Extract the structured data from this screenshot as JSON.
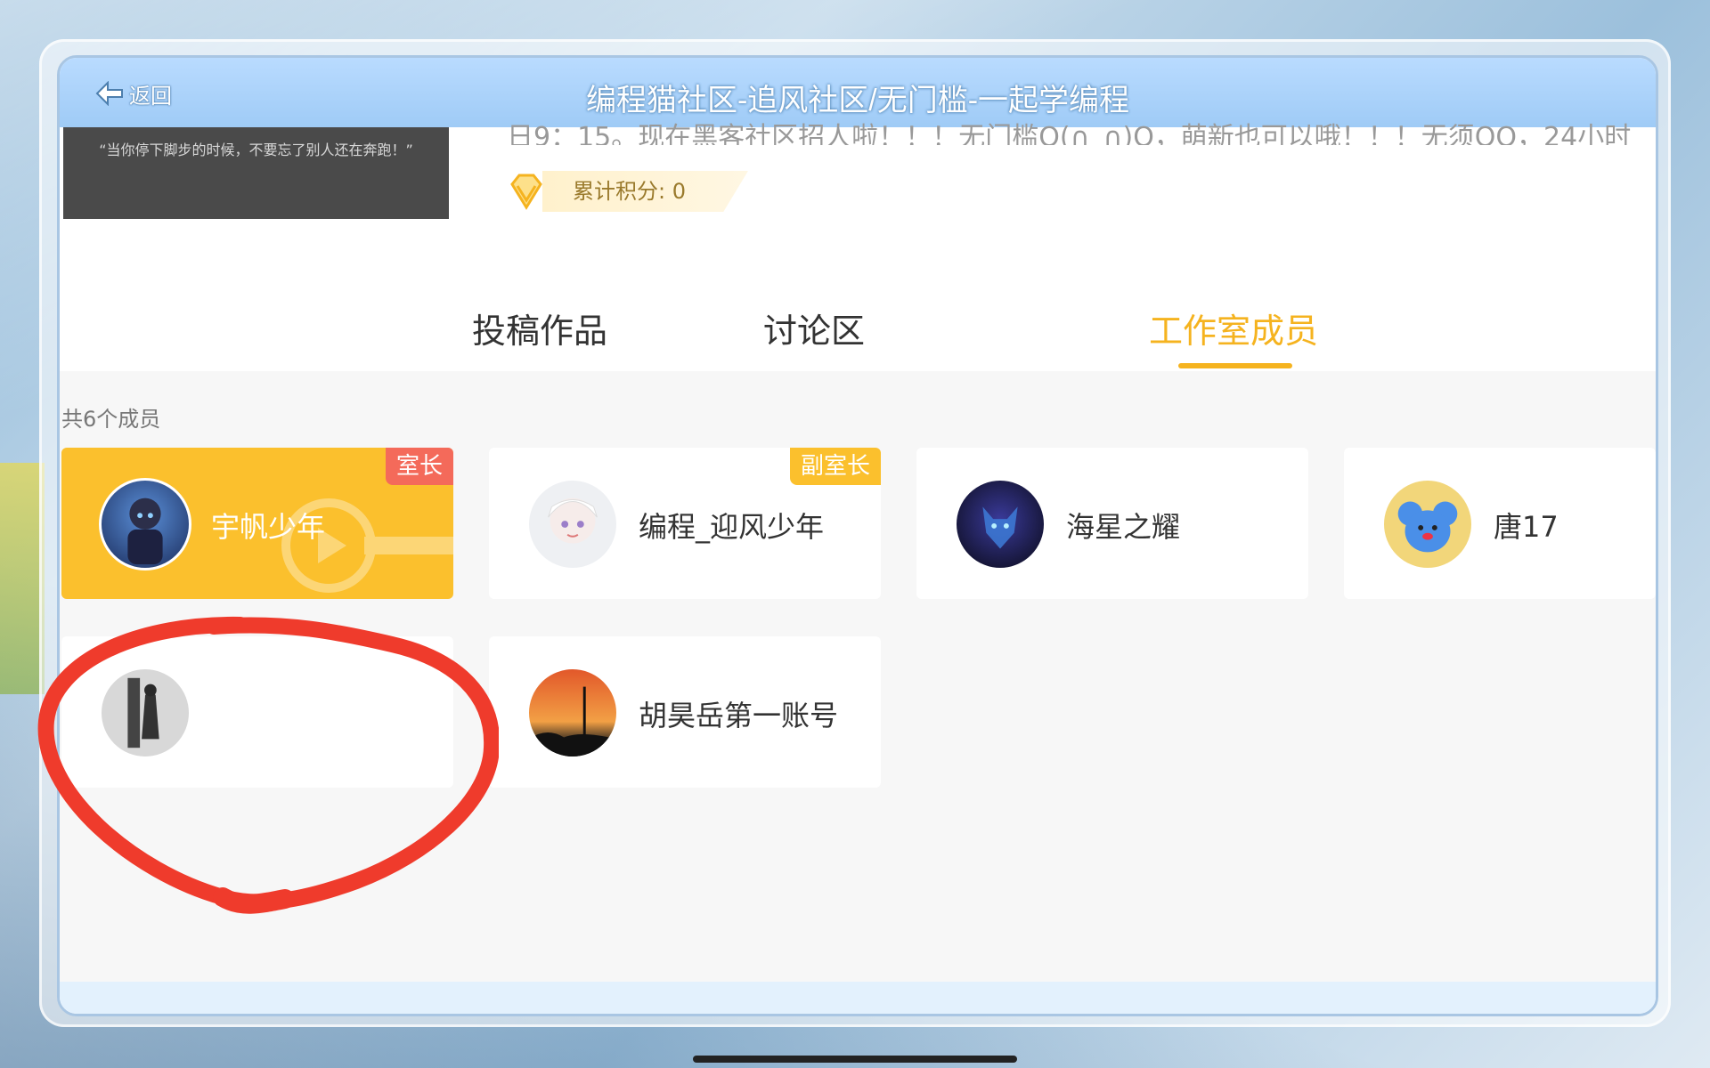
{
  "app": {
    "title": "编程猫社区-追风社区/无门槛-一起学编程",
    "back_label": "返回"
  },
  "studio": {
    "cover_quote": "“当你停下脚步的时候，不要忘了别人还在奔跑！”",
    "description": "日9：15。现在黑客社区招人啦！！！无门槛O(∩_∩)O，萌新也可以哦！！！无须QQ，24小时",
    "score_label": "累计积分: 0"
  },
  "tabs": [
    {
      "label": "投稿作品",
      "active": false
    },
    {
      "label": "讨论区",
      "active": false
    },
    {
      "label": "工作室成员",
      "active": true
    }
  ],
  "members": {
    "count_label": "共6个成员",
    "list": [
      {
        "name": "宇帆少年",
        "badge": "室长",
        "avatar_icon": "boy-avatar"
      },
      {
        "name": "编程_迎风少年",
        "badge": "副室长",
        "avatar_icon": "white-hair-avatar"
      },
      {
        "name": "海星之耀",
        "badge": "",
        "avatar_icon": "wolf-avatar"
      },
      {
        "name": "唐17",
        "badge": "",
        "avatar_icon": "blue-koala-avatar"
      },
      {
        "name": "",
        "badge": "",
        "avatar_icon": "silhouette-avatar"
      },
      {
        "name": "胡昊岳第一账号",
        "badge": "",
        "avatar_icon": "sunset-avatar"
      }
    ]
  },
  "colors": {
    "accent": "#f5b31f",
    "topbar": "#9fcbf6",
    "owner_badge": "#f46a5a",
    "annotation": "#ef3b2c"
  }
}
